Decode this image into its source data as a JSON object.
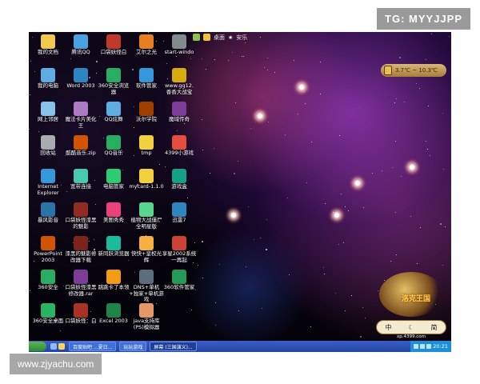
{
  "watermarks": {
    "top": "TG: MYYJJPP",
    "bottom": "www.zjyachu.com"
  },
  "topbar": {
    "items": [
      "桌面",
      "安乐"
    ]
  },
  "desktop_icons": [
    {
      "label": "我的文档",
      "color": "#f2c94c"
    },
    {
      "label": "腾讯QQ",
      "color": "#4aa3df"
    },
    {
      "label": "口袋妖怪白",
      "color": "#c0392b"
    },
    {
      "label": "艾尔之光",
      "color": "#e67e22"
    },
    {
      "label": "start-windo",
      "color": "#7f8c8d"
    },
    {
      "label": "我的电脑",
      "color": "#5dade2"
    },
    {
      "label": "Word 2003",
      "color": "#2e86c1"
    },
    {
      "label": "360安全浏览器",
      "color": "#27ae60"
    },
    {
      "label": "软件管家",
      "color": "#3498db"
    },
    {
      "label": "www.gg12.\n香香大战宝",
      "color": "#d4ac0d"
    },
    {
      "label": "网上邻居",
      "color": "#85c1e9"
    },
    {
      "label": "魔法卡片美化王",
      "color": "#af7ac5"
    },
    {
      "label": "QQ炫舞",
      "color": "#5dade2"
    },
    {
      "label": "沃尔学院",
      "color": "#a04000"
    },
    {
      "label": "魔域传奇",
      "color": "#7d3c98"
    },
    {
      "label": "回收站",
      "color": "#a6acaf"
    },
    {
      "label": "酷酷音乐.zip",
      "color": "#d35400"
    },
    {
      "label": "QQ音乐",
      "color": "#27ae60"
    },
    {
      "label": "tmp",
      "color": "#f4d03f"
    },
    {
      "label": "4399小游戏",
      "color": "#e74c3c"
    },
    {
      "label": "Internet\nExplorer",
      "color": "#3498db"
    },
    {
      "label": "宽带连接",
      "color": "#48c9b0"
    },
    {
      "label": "电脑管家",
      "color": "#2ecc71"
    },
    {
      "label": "mycard-1.1.0",
      "color": "#f4d03f"
    },
    {
      "label": "游戏盒",
      "color": "#16a085"
    },
    {
      "label": "暴风影音",
      "color": "#2874a6"
    },
    {
      "label": "口袋妖怪漆黑的魅影",
      "color": "#922b21"
    },
    {
      "label": "美图秀秀",
      "color": "#ec407a"
    },
    {
      "label": "植物大战僵尸全明星版",
      "color": "#58d68d"
    },
    {
      "label": "迅雷7",
      "color": "#2e86c1"
    },
    {
      "label": "PowerPoint\n2003",
      "color": "#d35400"
    },
    {
      "label": "漆黑的魅影修改器下载",
      "color": "#7b241c"
    },
    {
      "label": "新同跃浏览器",
      "color": "#1abc9c"
    },
    {
      "label": "快快+皇权光辉",
      "color": "#f5b041"
    },
    {
      "label": "享星2002系统一再起",
      "color": "#cb4335"
    },
    {
      "label": "360安全",
      "color": "#27ae60"
    },
    {
      "label": "口袋妖怪漆黑修改器.rar",
      "color": "#7d3c98"
    },
    {
      "label": "跳跳卡了本领",
      "color": "#f39c12"
    },
    {
      "label": "DNS+单机+独家+单机游戏",
      "color": "#5d6d7e"
    },
    {
      "label": "360软件管家",
      "color": "#229954"
    },
    {
      "label": "360安全桌面",
      "color": "#28b463"
    },
    {
      "label": "口袋妖怪：白",
      "color": "#a93226"
    },
    {
      "label": "Excel 2003",
      "color": "#1e8449"
    },
    {
      "label": "java支持库\n(PS)模拟器",
      "color": "#e59866"
    }
  ],
  "weather": {
    "text": "3.7℃ ~ 10.3℃"
  },
  "widget": {
    "brand": "洛克王国",
    "left_char": "中",
    "moon": "☾",
    "right_char": "简",
    "url": "xp.4399.com"
  },
  "taskbar": {
    "tasks": [
      "百度贴吧 ...夏日...",
      "玩玩游戏",
      "屏幕 (三国演义)..."
    ],
    "clock": "20:21"
  }
}
